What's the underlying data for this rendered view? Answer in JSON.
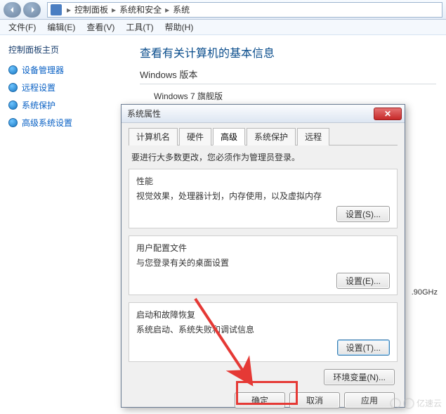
{
  "addressbar": {
    "crumbs": [
      "控制面板",
      "系统和安全",
      "系统"
    ]
  },
  "menu": {
    "file": "文件(F)",
    "edit": "编辑(E)",
    "view": "查看(V)",
    "tools": "工具(T)",
    "help": "帮助(H)"
  },
  "sidebar": {
    "head": "控制面板主页",
    "items": [
      {
        "label": "设备管理器"
      },
      {
        "label": "远程设置"
      },
      {
        "label": "系统保护"
      },
      {
        "label": "高级系统设置"
      }
    ]
  },
  "content": {
    "title": "查看有关计算机的基本信息",
    "win_sec": "Windows 版本",
    "win_ver": "Windows 7 旗舰版",
    "cpu_hz": ".90GHz"
  },
  "dialog": {
    "title": "系统属性",
    "tabs": {
      "computer": "计算机名",
      "hardware": "硬件",
      "advanced": "高级",
      "protect": "系统保护",
      "remote": "远程"
    },
    "hint": "要进行大多数更改，您必须作为管理员登录。",
    "g1": {
      "title": "性能",
      "desc": "视觉效果，处理器计划，内存使用，以及虚拟内存",
      "btn": "设置(S)..."
    },
    "g2": {
      "title": "用户配置文件",
      "desc": "与您登录有关的桌面设置",
      "btn": "设置(E)..."
    },
    "g3": {
      "title": "启动和故障恢复",
      "desc": "系统启动、系统失败和调试信息",
      "btn": "设置(T)..."
    },
    "env": "环境变量(N)...",
    "ok": "确定",
    "cancel": "取消",
    "apply": "应用"
  },
  "watermark": "亿速云"
}
